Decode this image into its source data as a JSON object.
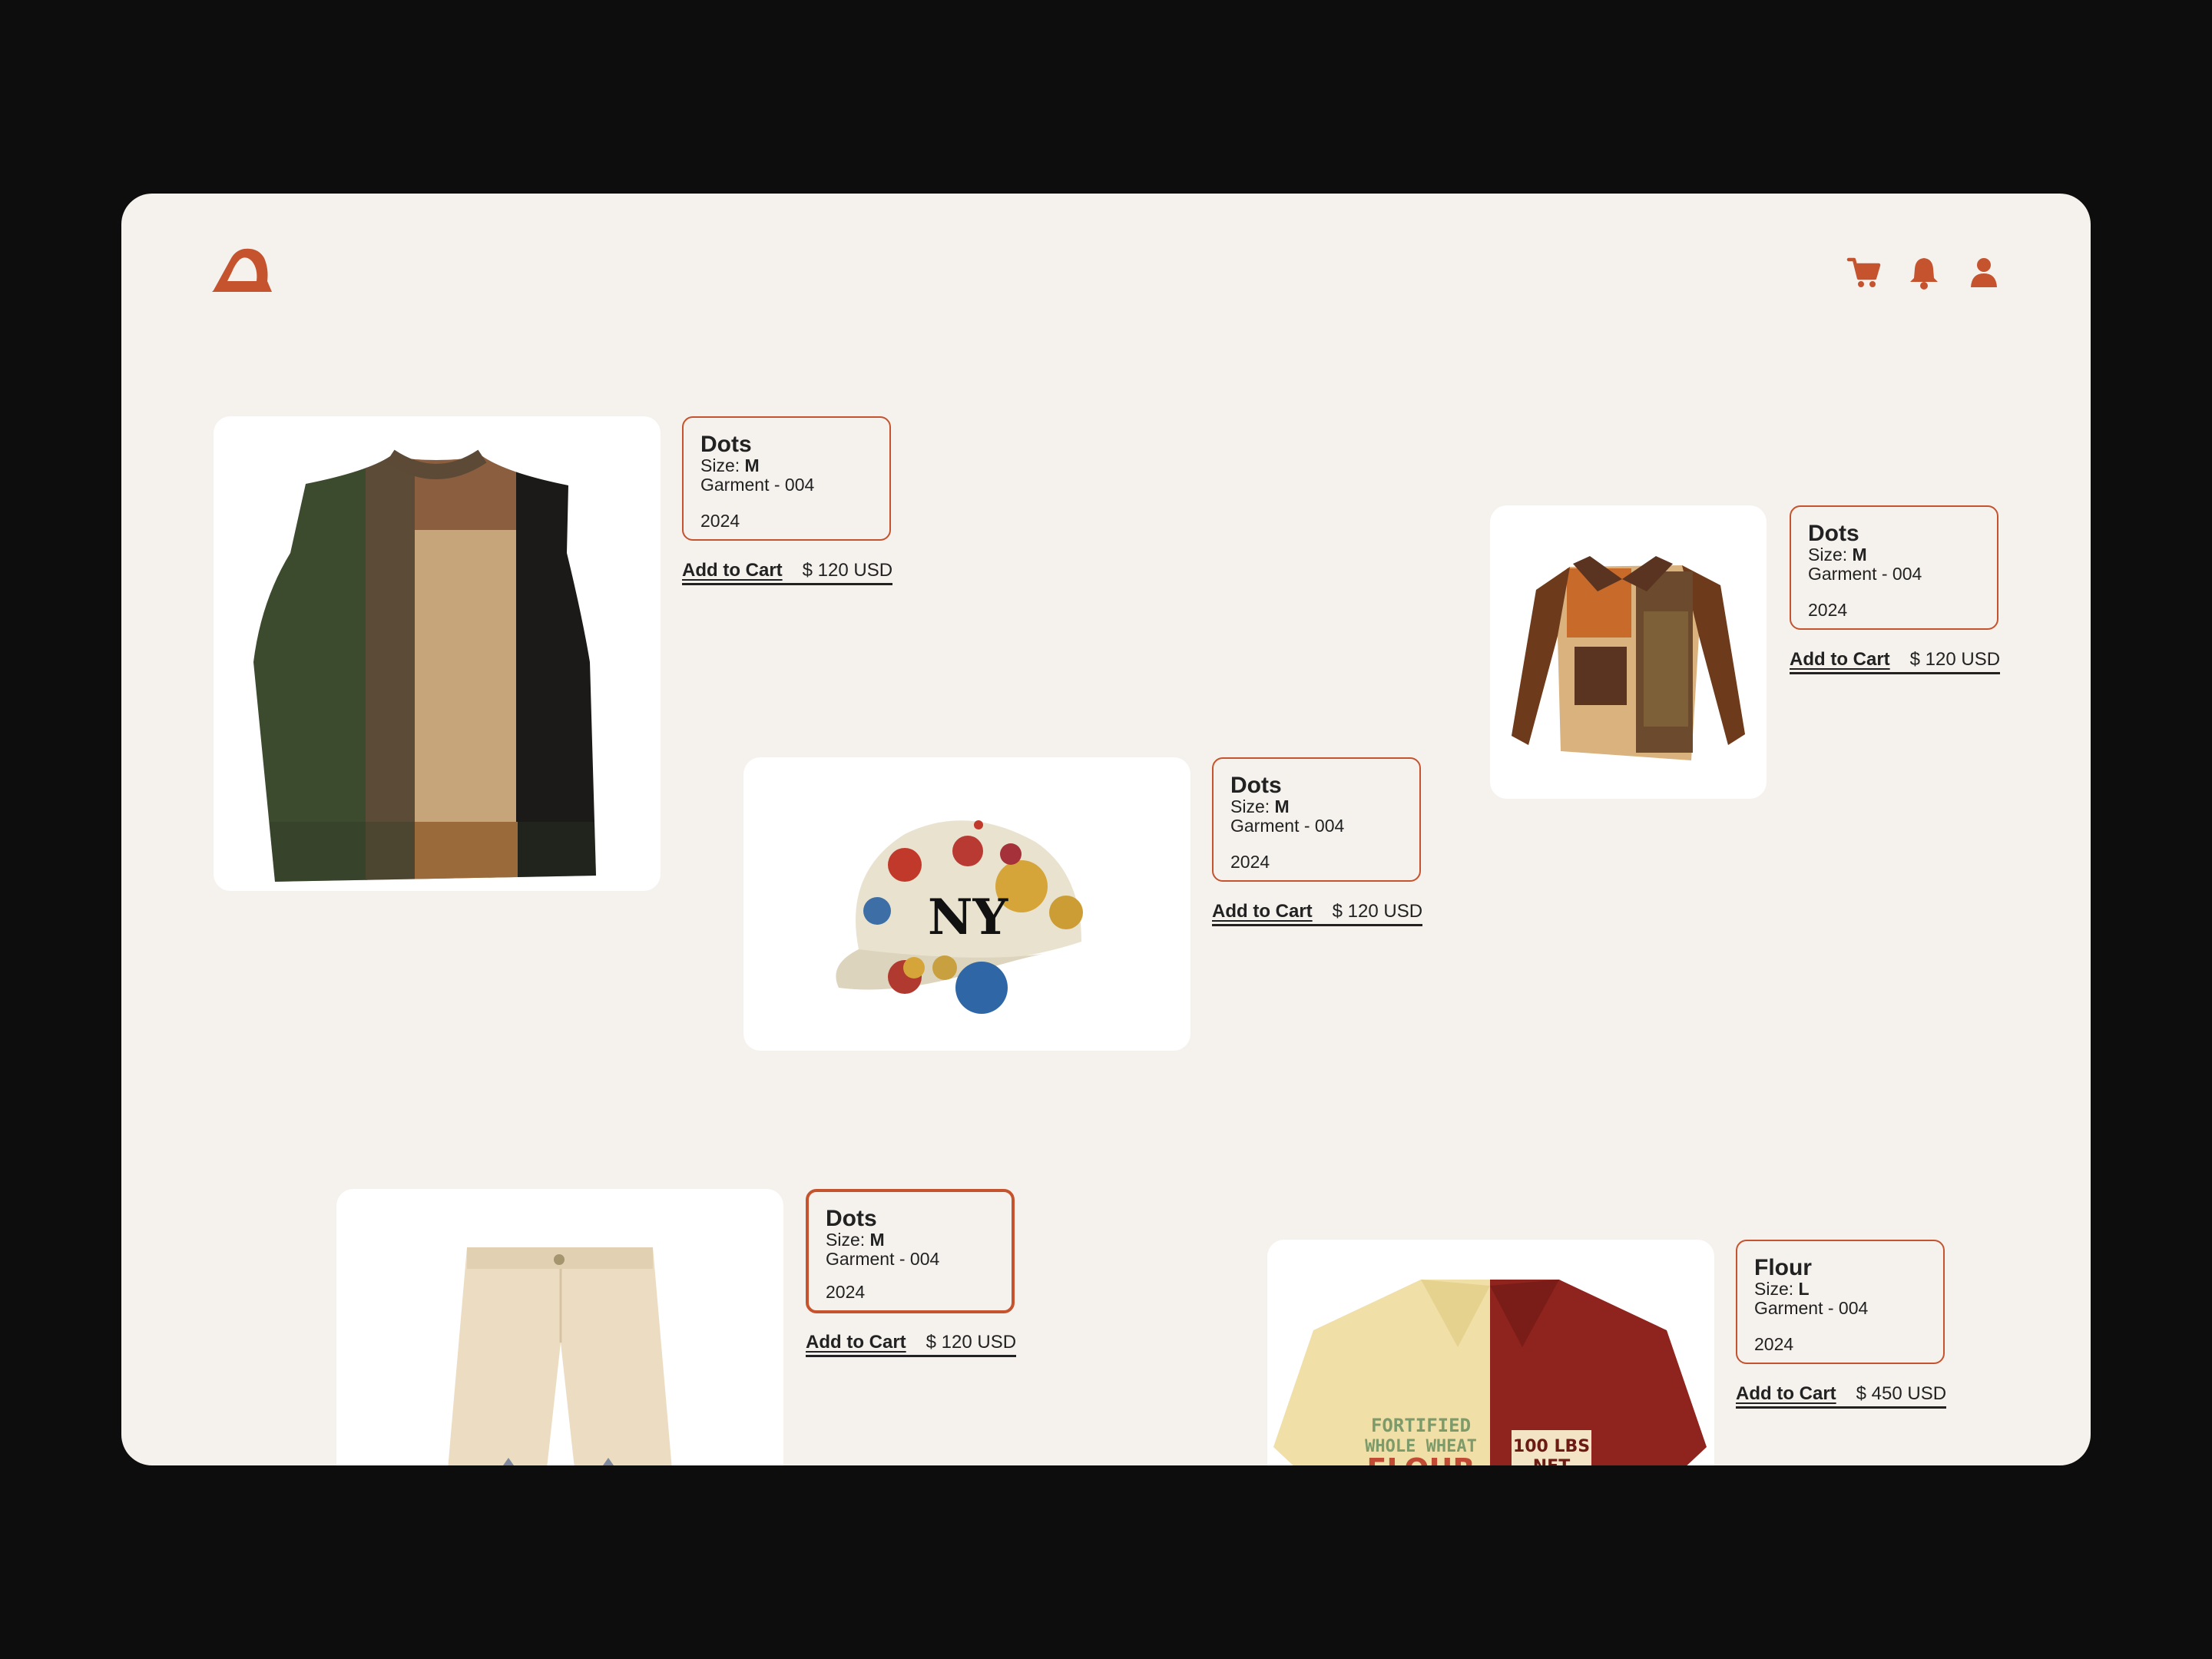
{
  "colors": {
    "accent": "#c4532e",
    "background": "#f5f2ee",
    "outer": "#0d0d0d",
    "text": "#222222"
  },
  "nav": {
    "icons": [
      "cart-icon",
      "bell-icon",
      "user-icon"
    ]
  },
  "products": [
    {
      "name": "Dots",
      "size_label": "Size:",
      "size": "M",
      "garment": "Garment - 004",
      "year": "2024",
      "cta": "Add to Cart",
      "price": "$ 120 USD",
      "image": "patchwork-vest"
    },
    {
      "name": "Dots",
      "size_label": "Size:",
      "size": "M",
      "garment": "Garment - 004",
      "year": "2024",
      "cta": "Add to Cart",
      "price": "$ 120 USD",
      "image": "patchwork-jacket"
    },
    {
      "name": "Dots",
      "size_label": "Size:",
      "size": "M",
      "garment": "Garment - 004",
      "year": "2024",
      "cta": "Add to Cart",
      "price": "$ 120 USD",
      "image": "dotted-cap"
    },
    {
      "name": "Dots",
      "size_label": "Size:",
      "size": "M",
      "garment": "Garment - 004",
      "year": "2024",
      "cta": "Add to Cart",
      "price": "$ 120 USD",
      "image": "cream-pants"
    },
    {
      "name": "Flour",
      "size_label": "Size:",
      "size": "L",
      "garment": "Garment - 004",
      "year": "2024",
      "cta": "Add to Cart",
      "price": "$ 450 USD",
      "image": "flour-shirt",
      "shirt_text": {
        "left_line1": "FORTIFIED",
        "left_line2": "WHOLE WHEAT",
        "left_line3": "FLOUR",
        "patch_line1": "100 LBS",
        "patch_line2": "NET"
      }
    }
  ]
}
